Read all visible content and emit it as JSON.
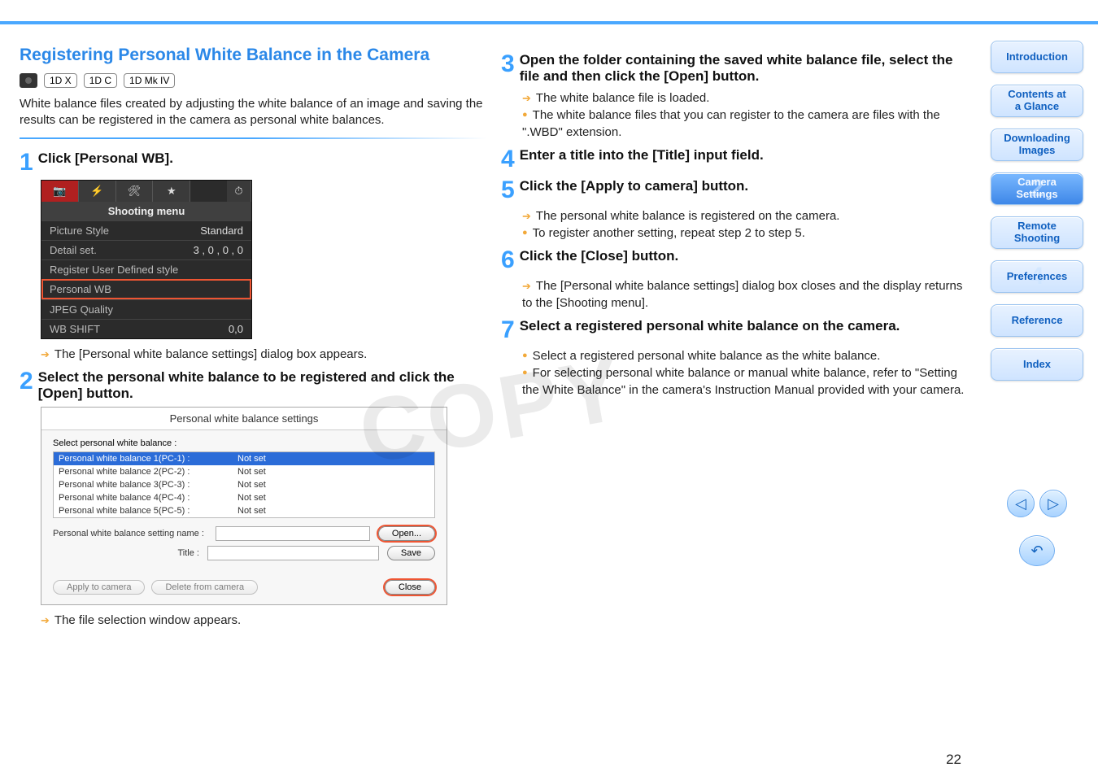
{
  "section_title": "Registering Personal White Balance in the Camera",
  "camera_badges": [
    "1D X",
    "1D C",
    "1D Mk IV"
  ],
  "intro_text": "White balance files created by adjusting the white balance of an image and saving the results can be registered in the camera as personal white balances.",
  "steps_left": [
    {
      "num": "1",
      "title": "Click [Personal WB].",
      "after_arrow": "The [Personal white balance settings] dialog box appears."
    },
    {
      "num": "2",
      "title": "Select the personal white balance to be registered and click the [Open] button.",
      "after_arrow": "The file selection window appears."
    }
  ],
  "shooting_menu": {
    "header": "Shooting menu",
    "rows": [
      {
        "k": "Picture Style",
        "v": "Standard"
      },
      {
        "k": "Detail set.",
        "v": "3 , 0 , 0 , 0"
      },
      {
        "k": "Register User Defined style",
        "v": ""
      },
      {
        "k": "Personal WB",
        "v": "",
        "hl": true
      },
      {
        "k": "JPEG Quality",
        "v": ""
      },
      {
        "k": "WB SHIFT",
        "v": "0,0"
      }
    ],
    "tab_icons": [
      "camera",
      "flash",
      "tools",
      "star",
      "timer"
    ]
  },
  "dialog": {
    "title": "Personal white balance settings",
    "list_label": "Select personal white balance :",
    "items": [
      {
        "n": "Personal white balance 1(PC-1)  :",
        "s": "Not set",
        "sel": true
      },
      {
        "n": "Personal white balance 2(PC-2)  :",
        "s": "Not set"
      },
      {
        "n": "Personal white balance 3(PC-3)  :",
        "s": "Not set"
      },
      {
        "n": "Personal white balance 4(PC-4)  :",
        "s": "Not set"
      },
      {
        "n": "Personal white balance 5(PC-5)  :",
        "s": "Not set"
      }
    ],
    "name_label": "Personal white balance setting name :",
    "title_label": "Title :",
    "open_btn": "Open...",
    "save_btn": "Save",
    "apply_btn": "Apply to camera",
    "delete_btn": "Delete from camera",
    "close_btn": "Close"
  },
  "steps_right": [
    {
      "num": "3",
      "title": "Open the folder containing the saved white balance file, select the file and then click the [Open] button.",
      "subs": [
        {
          "t": "arrow",
          "text": "The white balance file is loaded."
        },
        {
          "t": "dot",
          "text": "The white balance files that you can register to the camera are files with the \".WBD\" extension."
        }
      ]
    },
    {
      "num": "4",
      "title": "Enter a title into the [Title] input field.",
      "subs": []
    },
    {
      "num": "5",
      "title": "Click the [Apply to camera] button.",
      "subs": [
        {
          "t": "arrow",
          "text": "The personal white balance is registered on the camera."
        },
        {
          "t": "dot",
          "text": "To register another setting, repeat step 2 to step 5."
        }
      ]
    },
    {
      "num": "6",
      "title": "Click the [Close] button.",
      "subs": [
        {
          "t": "arrow",
          "text": "The [Personal white balance settings] dialog box closes and the display returns to the [Shooting menu]."
        }
      ]
    },
    {
      "num": "7",
      "title": "Select a registered personal white balance on the camera.",
      "subs": [
        {
          "t": "dot",
          "text": "Select a registered personal white balance as the white balance."
        },
        {
          "t": "dot",
          "text": "For selecting personal white balance or manual white balance, refer to \"Setting the White Balance\" in the camera's Instruction Manual provided with your camera."
        }
      ]
    }
  ],
  "nav": [
    {
      "label": "Introduction",
      "big": ""
    },
    {
      "label": "Contents at a Glance",
      "big": ""
    },
    {
      "label": "Downloading Images",
      "big": "1"
    },
    {
      "label": "Camera Settings",
      "big": "2",
      "active": true
    },
    {
      "label": "Remote Shooting",
      "big": "3"
    },
    {
      "label": "Preferences",
      "big": "4"
    },
    {
      "label": "Reference",
      "big": ""
    },
    {
      "label": "Index",
      "big": ""
    }
  ],
  "page_number": "22",
  "watermark": "COPY"
}
